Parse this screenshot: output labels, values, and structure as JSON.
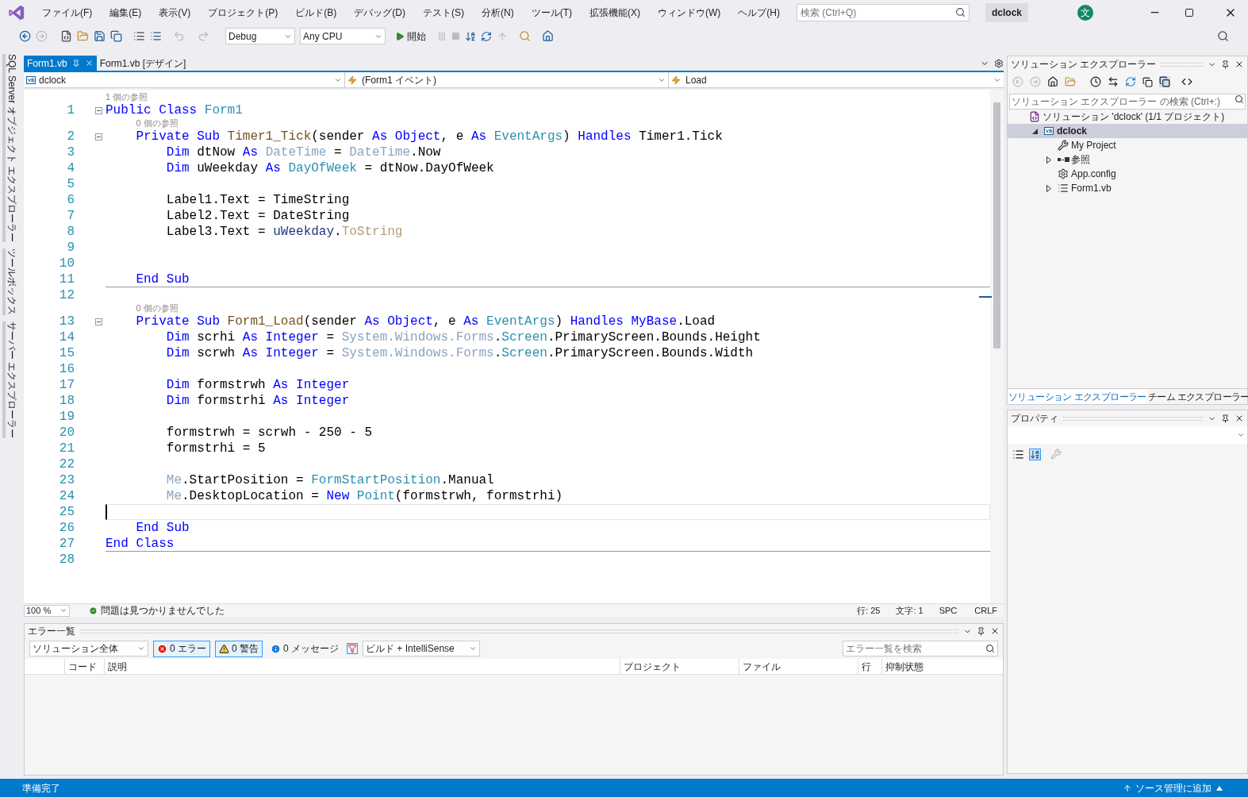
{
  "menu": [
    "ファイル(F)",
    "編集(E)",
    "表示(V)",
    "プロジェクト(P)",
    "ビルド(B)",
    "デバッグ(D)",
    "テスト(S)",
    "分析(N)",
    "ツール(T)",
    "拡張機能(X)",
    "ウィンドウ(W)",
    "ヘルプ(H)"
  ],
  "search": {
    "placeholder": "検索 (Ctrl+Q)"
  },
  "solution_badge": "dclock",
  "account_initial": "文",
  "toolbar": {
    "configuration": "Debug",
    "platform": "Any CPU",
    "start": "開始"
  },
  "side_tabs": [
    "SQL Server オブジェクト エクスプローラー",
    "ツールボックス",
    "サーバー エクスプローラー"
  ],
  "editor_tabs": [
    {
      "label": "Form1.vb",
      "selected": true
    },
    {
      "label": "Form1.vb [デザイン]",
      "selected": false
    }
  ],
  "nav_bar": {
    "project": "dclock",
    "object": "(Form1 イベント)",
    "member": "Load"
  },
  "code_lines": [
    {
      "n": "1",
      "hint": "1 個の参照",
      "fold": true,
      "separator": false,
      "current": false,
      "tokens": [
        {
          "text": "Public Class ",
          "kind": "kw"
        },
        {
          "text": "Form1",
          "kind": "type"
        }
      ]
    },
    {
      "n": "2",
      "hint": "0 個の参照",
      "fold": true,
      "separator": false,
      "current": false,
      "tokens": [
        {
          "text": "    Private Sub ",
          "kind": "kw"
        },
        {
          "text": "Timer1_Tick",
          "kind": "method"
        },
        {
          "text": "(sender ",
          "kind": "plain"
        },
        {
          "text": "As Object",
          "kind": "kw"
        },
        {
          "text": ", e ",
          "kind": "plain"
        },
        {
          "text": "As ",
          "kind": "kw"
        },
        {
          "text": "EventArgs",
          "kind": "type"
        },
        {
          "text": ") ",
          "kind": "plain"
        },
        {
          "text": "Handles ",
          "kind": "kw"
        },
        {
          "text": "Timer1.Tick",
          "kind": "plain"
        }
      ]
    },
    {
      "n": "3",
      "fold": false,
      "separator": false,
      "current": false,
      "tokens": [
        {
          "text": "        Dim ",
          "kind": "kw"
        },
        {
          "text": "dtNow ",
          "kind": "plain"
        },
        {
          "text": "As ",
          "kind": "kw"
        },
        {
          "text": "DateTime",
          "kind": "faded"
        },
        {
          "text": " = ",
          "kind": "plain"
        },
        {
          "text": "DateTime",
          "kind": "faded"
        },
        {
          "text": ".Now",
          "kind": "plain"
        }
      ]
    },
    {
      "n": "4",
      "fold": false,
      "separator": false,
      "current": false,
      "tokens": [
        {
          "text": "        Dim ",
          "kind": "kw"
        },
        {
          "text": "uWeekday ",
          "kind": "plain"
        },
        {
          "text": "As ",
          "kind": "kw"
        },
        {
          "text": "DayOfWeek",
          "kind": "type"
        },
        {
          "text": " = dtNow.DayOfWeek",
          "kind": "plain"
        }
      ]
    },
    {
      "n": "5",
      "fold": false,
      "separator": false,
      "current": false
    },
    {
      "n": "6",
      "fold": false,
      "separator": false,
      "current": false,
      "tokens": [
        {
          "text": "        Label1.Text = TimeString",
          "kind": "plain"
        }
      ]
    },
    {
      "n": "7",
      "fold": false,
      "separator": false,
      "current": false,
      "tokens": [
        {
          "text": "        Label2.Text = DateString",
          "kind": "plain"
        }
      ]
    },
    {
      "n": "8",
      "fold": false,
      "separator": false,
      "current": false,
      "tokens": [
        {
          "text": "        Label3.Text = ",
          "kind": "plain"
        },
        {
          "text": "uWeekday",
          "kind": "var"
        },
        {
          "text": ".",
          "kind": "plain"
        },
        {
          "text": "ToString",
          "kind": "fadedmethod"
        }
      ]
    },
    {
      "n": "9",
      "fold": false,
      "separator": false,
      "current": false
    },
    {
      "n": "10",
      "fold": false,
      "separator": false,
      "current": false
    },
    {
      "n": "11",
      "fold": false,
      "separator": true,
      "current": false,
      "tokens": [
        {
          "text": "    End Sub",
          "kind": "kw"
        }
      ]
    },
    {
      "n": "12",
      "fold": false,
      "separator": false,
      "current": false
    },
    {
      "n": "13",
      "hint": "0 個の参照",
      "fold": true,
      "separator": false,
      "current": false,
      "tokens": [
        {
          "text": "    Private Sub ",
          "kind": "kw"
        },
        {
          "text": "Form1_Load",
          "kind": "method"
        },
        {
          "text": "(sender ",
          "kind": "plain"
        },
        {
          "text": "As Object",
          "kind": "kw"
        },
        {
          "text": ", e ",
          "kind": "plain"
        },
        {
          "text": "As ",
          "kind": "kw"
        },
        {
          "text": "EventArgs",
          "kind": "type"
        },
        {
          "text": ") ",
          "kind": "plain"
        },
        {
          "text": "Handles MyBase",
          "kind": "kw"
        },
        {
          "text": ".Load",
          "kind": "plain"
        }
      ]
    },
    {
      "n": "14",
      "fold": false,
      "separator": false,
      "current": false,
      "tokens": [
        {
          "text": "        Dim ",
          "kind": "kw"
        },
        {
          "text": "scrhi ",
          "kind": "plain"
        },
        {
          "text": "As Integer",
          "kind": "kw"
        },
        {
          "text": " = ",
          "kind": "plain"
        },
        {
          "text": "System.Windows.Forms",
          "kind": "faded"
        },
        {
          "text": ".",
          "kind": "plain"
        },
        {
          "text": "Screen",
          "kind": "type"
        },
        {
          "text": ".PrimaryScreen.Bounds.Height",
          "kind": "plain"
        }
      ]
    },
    {
      "n": "15",
      "fold": false,
      "separator": false,
      "current": false,
      "tokens": [
        {
          "text": "        Dim ",
          "kind": "kw"
        },
        {
          "text": "scrwh ",
          "kind": "plain"
        },
        {
          "text": "As Integer",
          "kind": "kw"
        },
        {
          "text": " = ",
          "kind": "plain"
        },
        {
          "text": "System.Windows.Forms",
          "kind": "faded"
        },
        {
          "text": ".",
          "kind": "plain"
        },
        {
          "text": "Screen",
          "kind": "type"
        },
        {
          "text": ".PrimaryScreen.Bounds.Width",
          "kind": "plain"
        }
      ]
    },
    {
      "n": "16",
      "fold": false,
      "separator": false,
      "current": false
    },
    {
      "n": "17",
      "fold": false,
      "separator": false,
      "current": false,
      "tokens": [
        {
          "text": "        Dim ",
          "kind": "kw"
        },
        {
          "text": "formstrwh ",
          "kind": "plain"
        },
        {
          "text": "As Integer",
          "kind": "kw"
        }
      ]
    },
    {
      "n": "18",
      "fold": false,
      "separator": false,
      "current": false,
      "tokens": [
        {
          "text": "        Dim ",
          "kind": "kw"
        },
        {
          "text": "formstrhi ",
          "kind": "plain"
        },
        {
          "text": "As Integer",
          "kind": "kw"
        }
      ]
    },
    {
      "n": "19",
      "fold": false,
      "separator": false,
      "current": false
    },
    {
      "n": "20",
      "fold": false,
      "separator": false,
      "current": false,
      "tokens": [
        {
          "text": "        formstrwh = scrwh - 250 - 5",
          "kind": "plain"
        }
      ]
    },
    {
      "n": "21",
      "fold": false,
      "separator": false,
      "current": false,
      "tokens": [
        {
          "text": "        formstrhi = 5",
          "kind": "plain"
        }
      ]
    },
    {
      "n": "22",
      "fold": false,
      "separator": false,
      "current": false
    },
    {
      "n": "23",
      "fold": false,
      "separator": false,
      "current": false,
      "tokens": [
        {
          "text": "        Me",
          "kind": "faded"
        },
        {
          "text": ".StartPosition = ",
          "kind": "plain"
        },
        {
          "text": "FormStartPosition",
          "kind": "type"
        },
        {
          "text": ".Manual",
          "kind": "plain"
        }
      ]
    },
    {
      "n": "24",
      "fold": false,
      "separator": false,
      "current": false,
      "tokens": [
        {
          "text": "        Me",
          "kind": "faded"
        },
        {
          "text": ".DesktopLocation = ",
          "kind": "plain"
        },
        {
          "text": "New ",
          "kind": "kw"
        },
        {
          "text": "Point",
          "kind": "type"
        },
        {
          "text": "(formstrwh, formstrhi)",
          "kind": "plain"
        }
      ]
    },
    {
      "n": "25",
      "fold": false,
      "separator": false,
      "current": true
    },
    {
      "n": "26",
      "fold": false,
      "separator": false,
      "current": false,
      "tokens": [
        {
          "text": "    End Sub",
          "kind": "kw"
        }
      ]
    },
    {
      "n": "27",
      "fold": false,
      "separator": true,
      "current": false,
      "tokens": [
        {
          "text": "End Class",
          "kind": "kw"
        }
      ]
    },
    {
      "n": "28",
      "fold": false,
      "separator": false,
      "current": false
    }
  ],
  "editor_status": {
    "zoom": "100 %",
    "issues": "問題は見つかりませんでした",
    "line": "行: 25",
    "column": "文字: 1",
    "whitespace": "SPC",
    "line_ending": "CRLF"
  },
  "error_list": {
    "title": "エラー一覧",
    "scope": "ソリューション全体",
    "errors": "0 エラー",
    "warnings": "0 警告",
    "messages": "0 メッセージ",
    "source": "ビルド + IntelliSense",
    "search_placeholder": "エラー一覧を検索",
    "columns": [
      "コード",
      "説明",
      "プロジェクト",
      "ファイル",
      "行",
      "抑制状態"
    ]
  },
  "solution_explorer": {
    "title": "ソリューション エクスプローラー",
    "search_placeholder": "ソリューション エクスプローラー の検索 (Ctrl+:)",
    "tree": [
      {
        "label": "ソリューション 'dclock' (1/1 プロジェクト)",
        "kind": "solution",
        "selected": false,
        "children": [
          {
            "label": "dclock",
            "kind": "project",
            "selected": true,
            "expanded": true,
            "children": [
              {
                "label": "My Project",
                "kind": "settings",
                "selected": false
              },
              {
                "label": "参照",
                "kind": "references",
                "selected": false,
                "expanded": false
              },
              {
                "label": "App.config",
                "kind": "config",
                "selected": false
              },
              {
                "label": "Form1.vb",
                "kind": "form",
                "selected": false,
                "expanded": false
              }
            ]
          }
        ]
      }
    ],
    "tabs": [
      {
        "label": "ソリューション エクスプローラー",
        "selected": true
      },
      {
        "label": "チーム エクスプローラー",
        "selected": false
      }
    ]
  },
  "properties": {
    "title": "プロパティ"
  },
  "status_bar": {
    "message": "準備完了",
    "source_control": "ソース管理に追加"
  }
}
